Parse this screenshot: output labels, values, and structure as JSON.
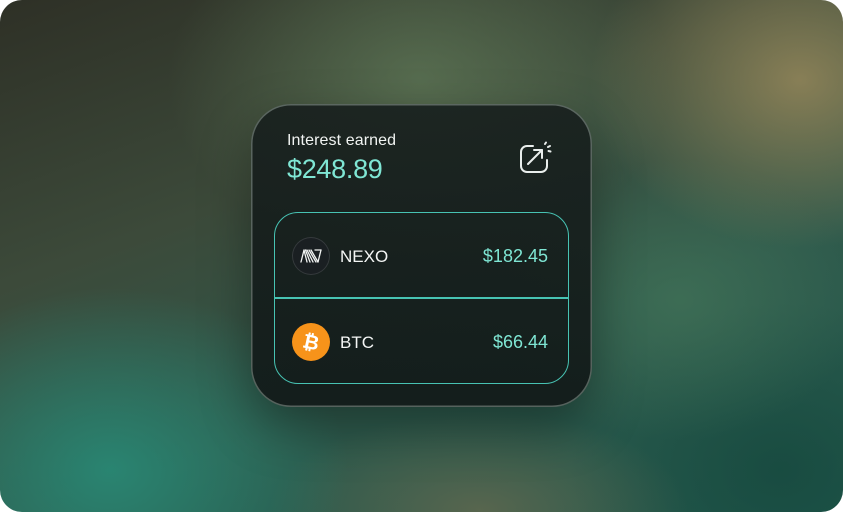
{
  "widget": {
    "title": "Interest earned",
    "total": "$248.89",
    "expand_icon": "expand-arrow-icon"
  },
  "assets": [
    {
      "name": "NEXO",
      "value": "$182.45",
      "icon": "nexo-logo-icon"
    },
    {
      "name": "BTC",
      "value": "$66.44",
      "icon": "bitcoin-logo-icon"
    }
  ],
  "colors": {
    "accent": "#7fe6d4",
    "border": "#47c3b3",
    "btc_orange": "#f7931a",
    "card_bg": "#18201e"
  }
}
